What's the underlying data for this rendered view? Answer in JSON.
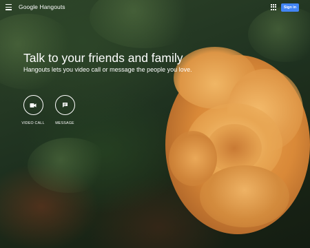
{
  "header": {
    "brand": "Google Hangouts",
    "signin_label": "Sign in"
  },
  "hero": {
    "title": "Talk to your friends and family",
    "subtitle": "Hangouts lets you video call or message the people you love."
  },
  "actions": [
    {
      "label": "VIDEO CALL",
      "icon": "video-camera-icon"
    },
    {
      "label": "MESSAGE",
      "icon": "message-icon"
    }
  ],
  "colors": {
    "accent": "#4285f4",
    "text": "#ffffff"
  }
}
